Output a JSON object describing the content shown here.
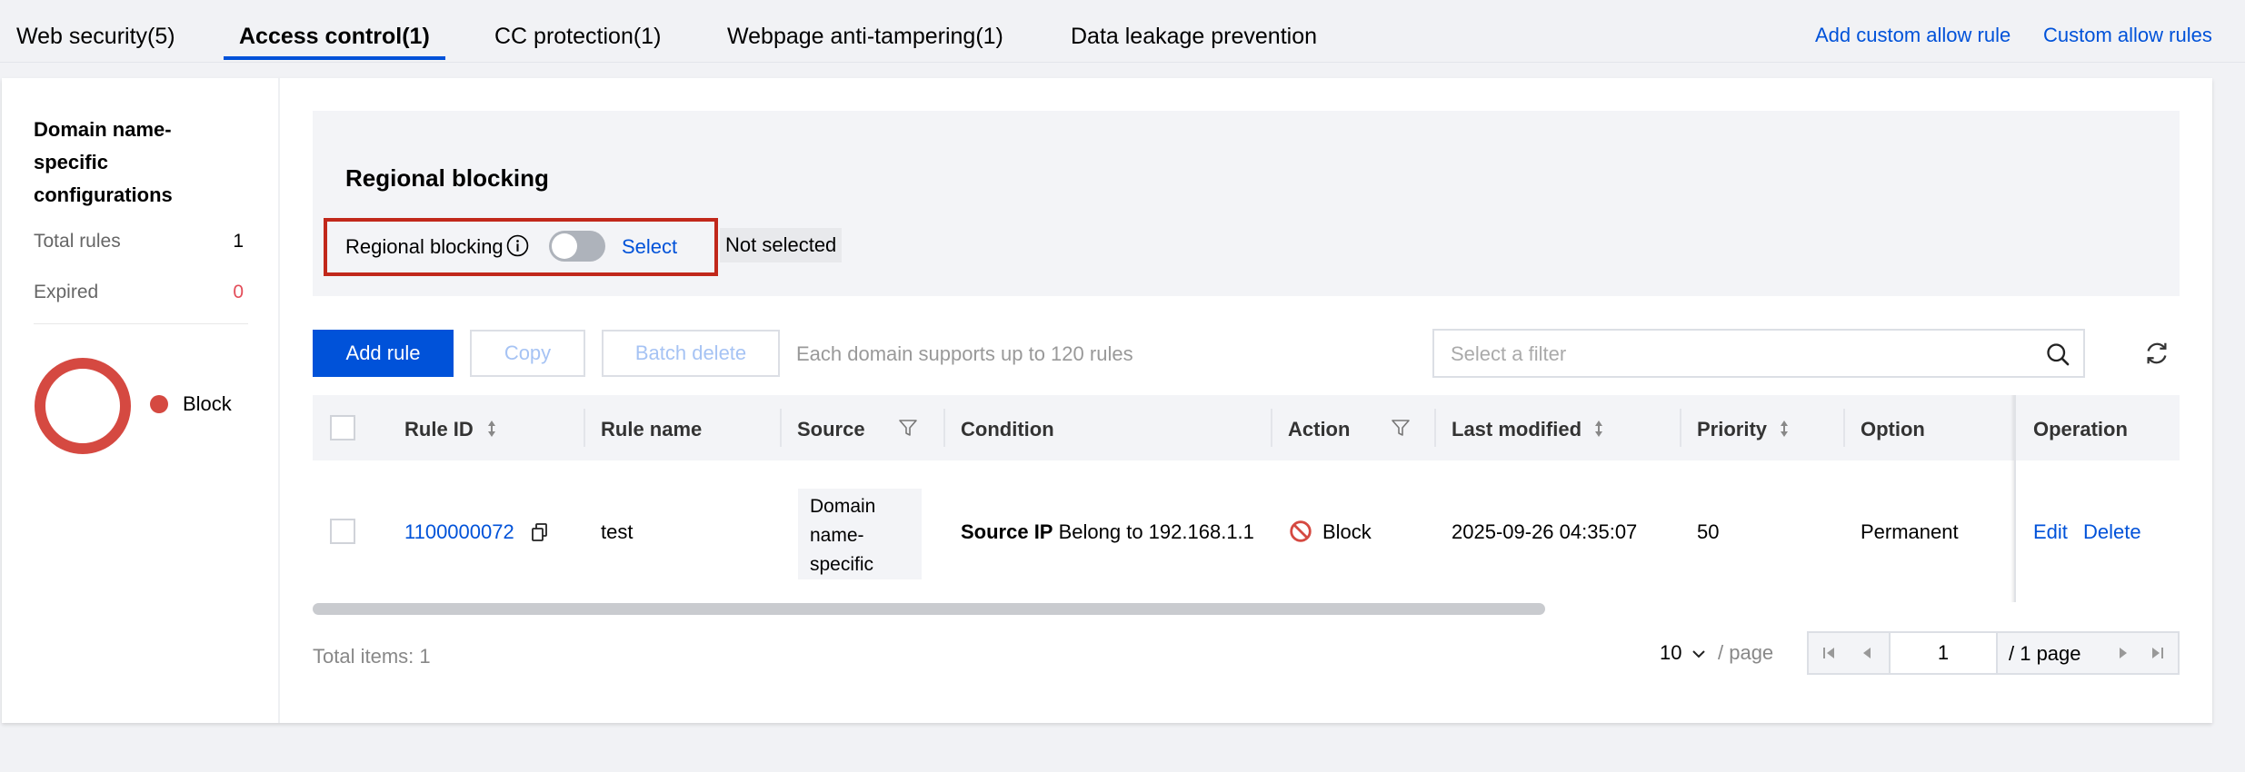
{
  "tabs": [
    {
      "label": "Web security(5)"
    },
    {
      "label": "Access control(1)"
    },
    {
      "label": "CC protection(1)"
    },
    {
      "label": "Webpage anti-tampering(1)"
    },
    {
      "label": "Data leakage prevention"
    }
  ],
  "top_links": {
    "add_custom_allow_rule": "Add custom allow rule",
    "custom_allow_rules": "Custom allow rules"
  },
  "sidebar": {
    "title": "Domain name-specific configurations",
    "total_rules_label": "Total rules",
    "total_rules_value": "1",
    "expired_label": "Expired",
    "expired_value": "0",
    "legend_label": "Block",
    "colors": {
      "block": "#d54941",
      "expired": "#e34d59"
    }
  },
  "regional_blocking": {
    "title": "Regional blocking",
    "label": "Regional blocking",
    "toggle_on": false,
    "select_link": "Select",
    "selection_status": "Not selected"
  },
  "toolbar": {
    "add_rule": "Add rule",
    "copy": "Copy",
    "batch_delete": "Batch delete",
    "hint": "Each domain supports up to 120 rules",
    "filter_placeholder": "Select a filter"
  },
  "table": {
    "columns": {
      "rule_id": "Rule ID",
      "rule_name": "Rule name",
      "source": "Source",
      "condition": "Condition",
      "action": "Action",
      "last_modified": "Last modified",
      "priority": "Priority",
      "option": "Option",
      "operation": "Operation"
    },
    "rows": [
      {
        "rule_id": "1100000072",
        "rule_name": "test",
        "source": "Domain name-specific",
        "condition_field": "Source IP",
        "condition_rest": "Belong to 192.168.1.1",
        "action": "Block",
        "last_modified": "2025-09-26 04:35:07",
        "priority": "50",
        "option": "Permanent",
        "edit": "Edit",
        "delete": "Delete"
      }
    ]
  },
  "pagination": {
    "total_items": "Total items: 1",
    "page_size": "10",
    "per_page": "/ page",
    "current_page": "1",
    "total_pages": "/ 1 page"
  },
  "colors": {
    "accent": "#0052d9",
    "highlight_border": "#c1281b"
  }
}
